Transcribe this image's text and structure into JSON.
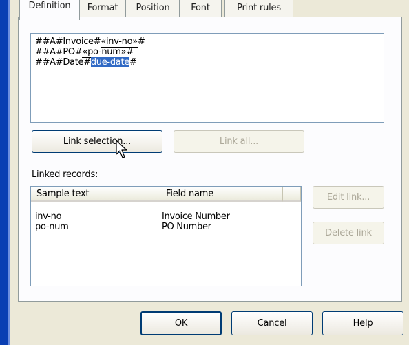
{
  "tabs": [
    {
      "label": "Definition"
    },
    {
      "label": "Format"
    },
    {
      "label": "Position"
    },
    {
      "label": "Font"
    },
    {
      "label": "Print rules"
    }
  ],
  "definition": {
    "lines": [
      {
        "prefix": "##A#Invoice#",
        "token": "«inv-no»",
        "suffix": "#"
      },
      {
        "prefix": "##A#PO#",
        "token": "«po-num»",
        "suffix": "#"
      },
      {
        "prefix": "##A#Date#",
        "selected": "due-date",
        "suffix": "#"
      }
    ]
  },
  "buttons": {
    "link_selection": "Link selection...",
    "link_all": "Link all...",
    "edit_link": "Edit link...",
    "delete_link": "Delete link",
    "ok": "OK",
    "cancel": "Cancel",
    "help": "Help"
  },
  "linked_records": {
    "label": "Linked records:",
    "columns": [
      "Sample text",
      "Field name"
    ],
    "rows": [
      {
        "sample": "inv-no",
        "field": "Invoice Number"
      },
      {
        "sample": "po-num",
        "field": "PO Number"
      }
    ]
  }
}
